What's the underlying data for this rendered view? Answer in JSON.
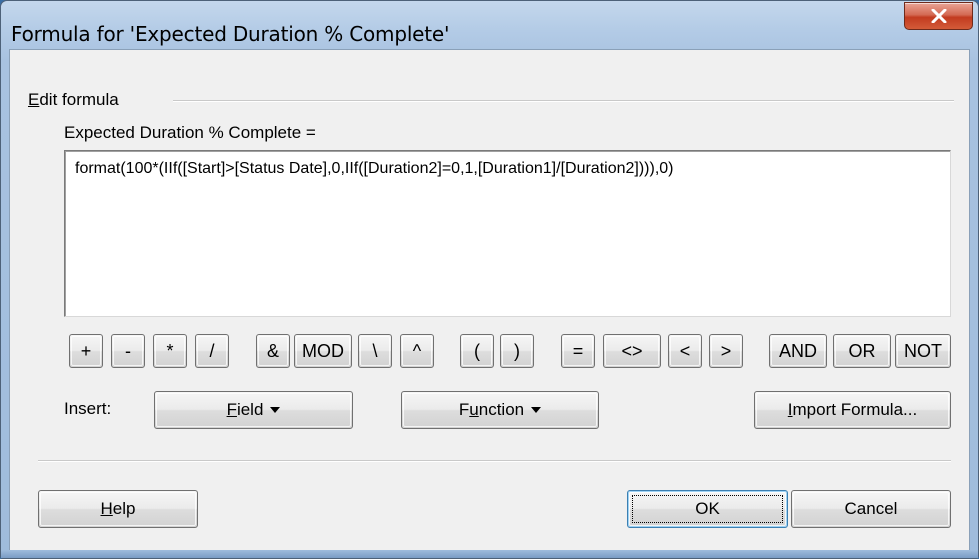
{
  "window": {
    "title": "Formula for 'Expected Duration % Complete'",
    "close_icon": "close-icon"
  },
  "group": {
    "label_underlined": "E",
    "label_rest": "dit formula"
  },
  "field": {
    "label": "Expected Duration % Complete =",
    "formula": "format(100*(IIf([Start]>[Status Date],0,IIf([Duration2]=0,1,[Duration1]/[Duration2]))),0)"
  },
  "operators": [
    "+",
    "-",
    "*",
    "/",
    "&",
    "MOD",
    "\\",
    "^",
    "(",
    ")",
    "=",
    "<>",
    "<",
    ">",
    "AND",
    "OR",
    "NOT"
  ],
  "insert": {
    "label": "Insert:",
    "field_button": {
      "underlined": "F",
      "rest": "ield"
    },
    "function_button": {
      "before": "F",
      "underlined": "u",
      "rest": "nction"
    },
    "import_button": {
      "underlined": "I",
      "rest": "mport Formula..."
    }
  },
  "footer": {
    "help_button": {
      "underlined": "H",
      "rest": "elp"
    },
    "ok_button": "OK",
    "cancel_button": "Cancel"
  }
}
